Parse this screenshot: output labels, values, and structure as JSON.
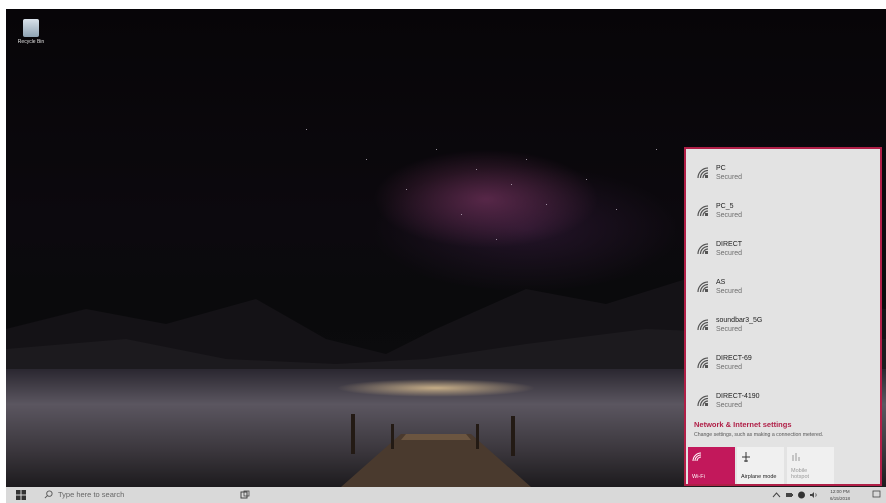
{
  "desktop": {
    "recycle_bin_label": "Recycle Bin"
  },
  "flyout": {
    "networks": [
      {
        "name": "PC",
        "status": "Secured"
      },
      {
        "name": "PC_5",
        "status": "Secured"
      },
      {
        "name": "DIRECT",
        "status": "Secured"
      },
      {
        "name": "AS",
        "status": "Secured"
      },
      {
        "name": "soundbar3_5G",
        "status": "Secured"
      },
      {
        "name": "DIRECT-69",
        "status": "Secured"
      },
      {
        "name": "DIRECT-4190",
        "status": "Secured"
      }
    ],
    "settings_link": "Network & Internet settings",
    "settings_desc": "Change settings, such as making a connection metered.",
    "tiles": {
      "wifi": "Wi-Fi",
      "airplane": "Airplane mode",
      "hotspot_line1": "Mobile",
      "hotspot_line2": "hotspot"
    },
    "accent_color": "#c2185b"
  },
  "taskbar": {
    "search_placeholder": "Type here to search",
    "clock_time": "12:00 PM",
    "clock_date": "6/15/2018"
  }
}
